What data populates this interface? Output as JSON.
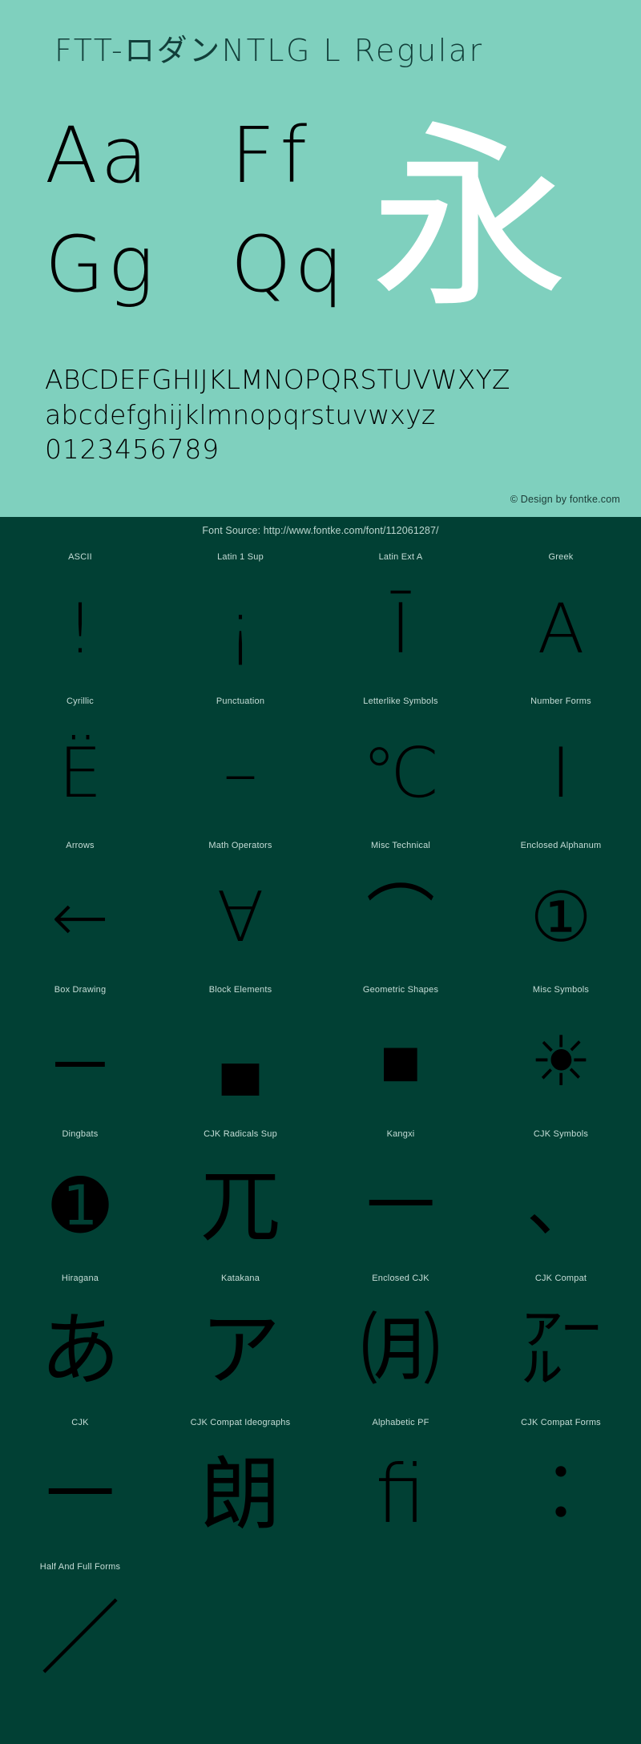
{
  "colors": {
    "top_background": "#7fd0be",
    "bottom_background": "#014034",
    "title_text": "#123f3a",
    "glyph_black": "#000000",
    "glyph_white": "#ffffff",
    "label_text": "#c6ddd7"
  },
  "header": {
    "font_title": "FTT-ロダンNTLG L Regular"
  },
  "specimen": {
    "pairs": [
      {
        "name": "Aa",
        "text": "Aa",
        "color": "#000000"
      },
      {
        "name": "Ff",
        "text": "Ff",
        "color": "#000000"
      },
      {
        "name": "Gg",
        "text": "Gg",
        "color": "#000000"
      },
      {
        "name": "Qq",
        "text": "Qq",
        "color": "#000000"
      }
    ],
    "kanji": "永",
    "uppercase": "ABCDEFGHIJKLMNOPQRSTUVWXYZ",
    "lowercase": "abcdefghijklmnopqrstuvwxyz",
    "digits": "0123456789"
  },
  "credit": "© Design by fontke.com",
  "font_source": "Font Source: http://www.fontke.com/font/112061287/",
  "unicode_blocks": [
    {
      "label": "ASCII",
      "glyph": "!",
      "size": "normal"
    },
    {
      "label": "Latin 1 Sup",
      "glyph": "¡",
      "size": "normal"
    },
    {
      "label": "Latin Ext A",
      "glyph": "Ī",
      "size": "normal"
    },
    {
      "label": "Greek",
      "glyph": "Α",
      "size": "normal"
    },
    {
      "label": "Cyrillic",
      "glyph": "Ё",
      "size": "normal"
    },
    {
      "label": "Punctuation",
      "glyph": "–",
      "size": "normal"
    },
    {
      "label": "Letterlike Symbols",
      "glyph": "℃",
      "size": "normal"
    },
    {
      "label": "Number Forms",
      "glyph": "Ⅰ",
      "size": "normal"
    },
    {
      "label": "Arrows",
      "glyph": "←",
      "size": "normal"
    },
    {
      "label": "Math Operators",
      "glyph": "∀",
      "size": "normal"
    },
    {
      "label": "Misc Technical",
      "glyph": "⌒",
      "size": "normal"
    },
    {
      "label": "Enclosed Alphanum",
      "glyph": "①",
      "size": "normal"
    },
    {
      "label": "Box Drawing",
      "glyph": "─",
      "size": "normal"
    },
    {
      "label": "Block Elements",
      "glyph": "▄",
      "size": "small"
    },
    {
      "label": "Geometric Shapes",
      "glyph": "■",
      "size": "normal"
    },
    {
      "label": "Misc Symbols",
      "glyph": "☀",
      "size": "normal"
    },
    {
      "label": "Dingbats",
      "glyph": "➊",
      "size": "normal"
    },
    {
      "label": "CJK Radicals Sup",
      "glyph": "兀",
      "size": "tall"
    },
    {
      "label": "Kangxi",
      "glyph": "一",
      "size": "normal"
    },
    {
      "label": "CJK Symbols",
      "glyph": "、",
      "size": "normal"
    },
    {
      "label": "Hiragana",
      "glyph": "あ",
      "size": "tall"
    },
    {
      "label": "Katakana",
      "glyph": "ア",
      "size": "tall"
    },
    {
      "label": "Enclosed CJK",
      "glyph": "㈪",
      "size": "tall"
    },
    {
      "label": "CJK Compat",
      "glyph": "㌃",
      "size": "tall"
    },
    {
      "label": "CJK",
      "glyph": "一",
      "size": "normal"
    },
    {
      "label": "CJK Compat Ideographs",
      "glyph": "朗",
      "size": "tall"
    },
    {
      "label": "Alphabetic PF",
      "glyph": "ﬁ",
      "size": "tall"
    },
    {
      "label": "CJK Compat Forms",
      "glyph": "︰",
      "size": "tall"
    },
    {
      "label": "Half And Full Forms",
      "glyph": "／",
      "size": "tall"
    }
  ]
}
